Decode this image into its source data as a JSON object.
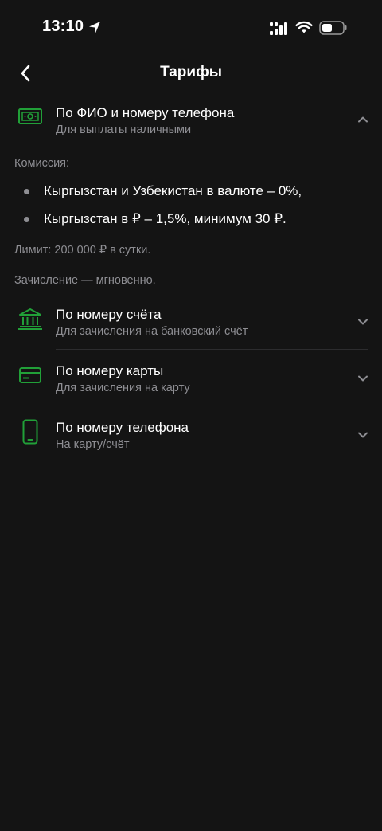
{
  "status_bar": {
    "time": "13:10"
  },
  "header": {
    "title": "Тарифы"
  },
  "accent_color": "#21A038",
  "expanded_option": {
    "icon": "banknote-icon",
    "title": "По ФИО и номеру телефона",
    "subtitle": "Для выплаты наличными",
    "commission_label": "Комиссия:",
    "bullets": [
      "Кыргызстан и Узбекистан в валюте – 0%,",
      "Кыргызстан в ₽ – 1,5%, минимум 30 ₽."
    ],
    "limit_text": "Лимит: 200 000 ₽ в сутки.",
    "credit_text": "Зачисление — мгновенно."
  },
  "options": [
    {
      "icon": "bank-icon",
      "title": "По номеру счёта",
      "subtitle": "Для зачисления на банковский счёт"
    },
    {
      "icon": "card-icon",
      "title": "По номеру карты",
      "subtitle": "Для зачисления на карту"
    },
    {
      "icon": "phone-icon",
      "title": "По номеру телефона",
      "subtitle": "На карту/счёт"
    }
  ]
}
